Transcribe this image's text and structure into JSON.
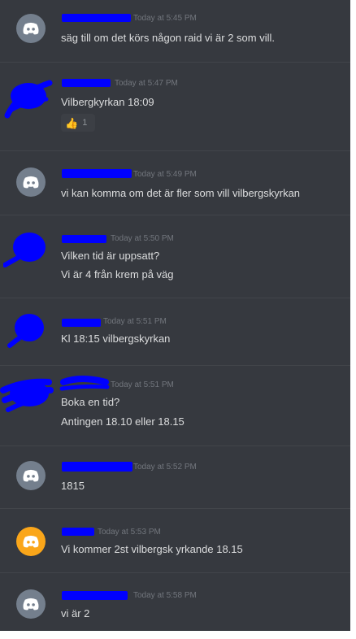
{
  "messages": [
    {
      "timestamp": "Today at 5:45 PM",
      "lines": [
        "säg till om det körs någon raid vi är 2 som vill."
      ],
      "avatar": "discord-gray"
    },
    {
      "timestamp": "Today at 5:47 PM",
      "lines": [
        "Vilbergkyrkan 18:09"
      ],
      "avatar": "scribbled",
      "reaction": {
        "emoji": "👍",
        "count": "1"
      }
    },
    {
      "timestamp": "Today at 5:49 PM",
      "lines": [
        "vi kan komma om det är fler som vill vilbergskyrkan"
      ],
      "avatar": "discord-gray"
    },
    {
      "timestamp": "Today at 5:50 PM",
      "lines": [
        "Vilken tid är uppsatt?",
        "Vi är 4 från krem på väg"
      ],
      "avatar": "scribbled"
    },
    {
      "timestamp": "Today at 5:51 PM",
      "lines": [
        "Kl 18:15 vilbergskyrkan"
      ],
      "avatar": "scribbled"
    },
    {
      "timestamp": "Today at 5:51 PM",
      "lines": [
        "Boka en tid?",
        "Antingen 18.10 eller 18.15"
      ],
      "avatar": "scribbled"
    },
    {
      "timestamp": "Today at 5:52 PM",
      "lines": [
        "1815"
      ],
      "avatar": "discord-gray"
    },
    {
      "timestamp": "Today at 5:53 PM",
      "lines": [
        "Vi kommer 2st vilbergsk yrkande 18.15"
      ],
      "avatar": "discord-orange"
    },
    {
      "timestamp": "Today at 5:58 PM",
      "lines": [
        "vi är 2"
      ],
      "avatar": "discord-gray"
    }
  ],
  "colors": {
    "background": "#36393f",
    "text": "#dcddde",
    "timestamp": "#72767d",
    "redaction": "#0000ff",
    "avatar_gray": "#747f8d",
    "avatar_orange": "#faa61a"
  },
  "icons": {
    "default_avatar": "discord-logo-icon",
    "reaction": "thumbs-up-icon"
  }
}
